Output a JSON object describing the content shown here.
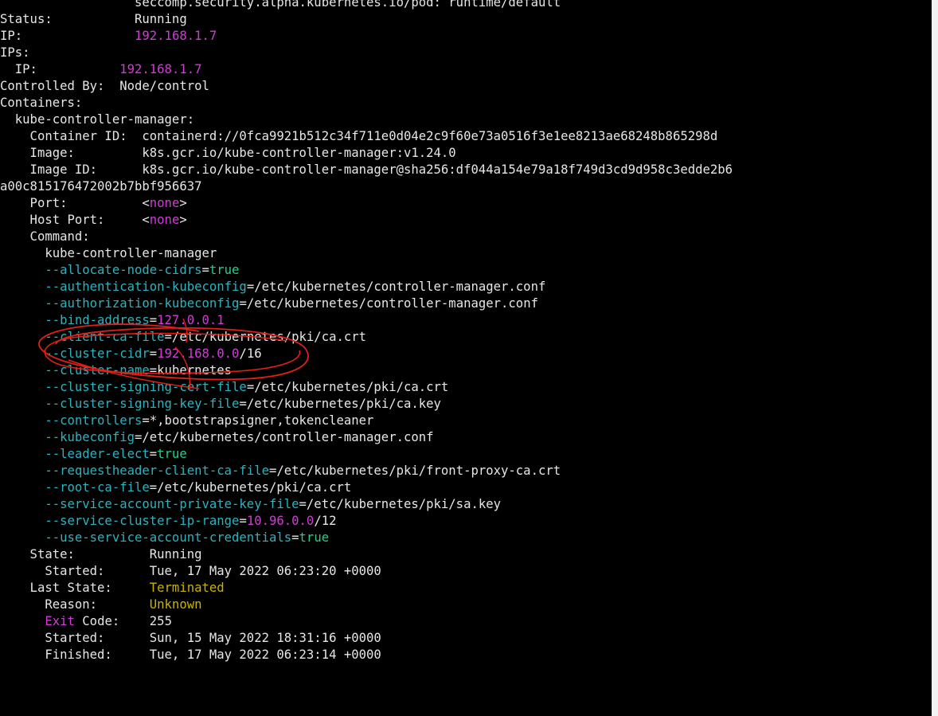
{
  "terminal": {
    "colors": {
      "background": "#000000",
      "text": "#e6e6e6",
      "flag": "#2bb3c0",
      "bool": "#23d18b",
      "number": "#d33ad8",
      "state": "#c8b400",
      "annotation": "#e0201a"
    },
    "lines": [
      [
        {
          "t": "                  seccomp.security.alpha.kubernetes.io/pod: runtime/default",
          "c": "white"
        }
      ],
      [
        {
          "t": "Status:           Running",
          "c": "white"
        }
      ],
      [
        {
          "t": "IP:               ",
          "c": "white"
        },
        {
          "t": "192.168.1.7",
          "c": "magenta"
        }
      ],
      [
        {
          "t": "IPs:",
          "c": "white"
        }
      ],
      [
        {
          "t": "  IP:           ",
          "c": "white"
        },
        {
          "t": "192.168.1.7",
          "c": "magenta"
        }
      ],
      [
        {
          "t": "Controlled By:  Node/control",
          "c": "white"
        }
      ],
      [
        {
          "t": "Containers:",
          "c": "white"
        }
      ],
      [
        {
          "t": "  kube-controller-manager:",
          "c": "white"
        }
      ],
      [
        {
          "t": "    Container ID:  containerd://0fca9921b512c34f711e0d04e2c9f60e73a0516f3e1ee8213ae68248b865298d",
          "c": "white"
        }
      ],
      [
        {
          "t": "    Image:         k8s.gcr.io/kube-controller-manager:v1.24.0",
          "c": "white"
        }
      ],
      [
        {
          "t": "    Image ID:      k8s.gcr.io/kube-controller-manager@sha256:df044a154e79a18f749d3cd9d958c3edde2b6",
          "c": "white"
        }
      ],
      [
        {
          "t": "a00c815176472002b7bbf956637",
          "c": "white"
        }
      ],
      [
        {
          "t": "    Port:          ",
          "c": "white"
        },
        {
          "t": "<",
          "c": "white"
        },
        {
          "t": "none",
          "c": "magenta"
        },
        {
          "t": ">",
          "c": "white"
        }
      ],
      [
        {
          "t": "    Host Port:     ",
          "c": "white"
        },
        {
          "t": "<",
          "c": "white"
        },
        {
          "t": "none",
          "c": "magenta"
        },
        {
          "t": ">",
          "c": "white"
        }
      ],
      [
        {
          "t": "    Command:",
          "c": "white"
        }
      ],
      [
        {
          "t": "      kube-controller-manager",
          "c": "white"
        }
      ],
      [
        {
          "t": "      --allocate-node-cidrs",
          "c": "cyan"
        },
        {
          "t": "=",
          "c": "white"
        },
        {
          "t": "true",
          "c": "green"
        }
      ],
      [
        {
          "t": "      --authentication-kubeconfig",
          "c": "cyan"
        },
        {
          "t": "=/etc/kubernetes/controller-manager.conf",
          "c": "white"
        }
      ],
      [
        {
          "t": "      --authorization-kubeconfig",
          "c": "cyan"
        },
        {
          "t": "=/etc/kubernetes/controller-manager.conf",
          "c": "white"
        }
      ],
      [
        {
          "t": "      --bind-address",
          "c": "cyan"
        },
        {
          "t": "=",
          "c": "white"
        },
        {
          "t": "127.0.0.1",
          "c": "magenta"
        }
      ],
      [
        {
          "t": "      --client-ca-file",
          "c": "cyan"
        },
        {
          "t": "=/etc/kubernetes/pki/ca.crt",
          "c": "white"
        }
      ],
      [
        {
          "t": "      --cluster-cidr",
          "c": "cyan"
        },
        {
          "t": "=",
          "c": "white"
        },
        {
          "t": "192.168.0.0",
          "c": "magenta"
        },
        {
          "t": "/16",
          "c": "white"
        }
      ],
      [
        {
          "t": "      --cluster-name",
          "c": "cyan"
        },
        {
          "t": "=kubernetes",
          "c": "white"
        }
      ],
      [
        {
          "t": "      --cluster-signing-cert-file",
          "c": "cyan"
        },
        {
          "t": "=/etc/kubernetes/pki/ca.crt",
          "c": "white"
        }
      ],
      [
        {
          "t": "      --cluster-signing-key-file",
          "c": "cyan"
        },
        {
          "t": "=/etc/kubernetes/pki/ca.key",
          "c": "white"
        }
      ],
      [
        {
          "t": "      --controllers",
          "c": "cyan"
        },
        {
          "t": "=*,bootstrapsigner,tokencleaner",
          "c": "white"
        }
      ],
      [
        {
          "t": "      --kubeconfig",
          "c": "cyan"
        },
        {
          "t": "=/etc/kubernetes/controller-manager.conf",
          "c": "white"
        }
      ],
      [
        {
          "t": "      --leader-elect",
          "c": "cyan"
        },
        {
          "t": "=",
          "c": "white"
        },
        {
          "t": "true",
          "c": "green"
        }
      ],
      [
        {
          "t": "      --requestheader-client-ca-file",
          "c": "cyan"
        },
        {
          "t": "=/etc/kubernetes/pki/front-proxy-ca.crt",
          "c": "white"
        }
      ],
      [
        {
          "t": "      --root-ca-file",
          "c": "cyan"
        },
        {
          "t": "=/etc/kubernetes/pki/ca.crt",
          "c": "white"
        }
      ],
      [
        {
          "t": "      --service-account-private-key-file",
          "c": "cyan"
        },
        {
          "t": "=/etc/kubernetes/pki/sa.key",
          "c": "white"
        }
      ],
      [
        {
          "t": "      --service-cluster-ip-range",
          "c": "cyan"
        },
        {
          "t": "=",
          "c": "white"
        },
        {
          "t": "10.96.0.0",
          "c": "magenta"
        },
        {
          "t": "/12",
          "c": "white"
        }
      ],
      [
        {
          "t": "      --use-service-account-credentials",
          "c": "cyan"
        },
        {
          "t": "=",
          "c": "white"
        },
        {
          "t": "true",
          "c": "green"
        }
      ],
      [
        {
          "t": "    State:          Running",
          "c": "white"
        }
      ],
      [
        {
          "t": "      Started:      Tue, 17 May 2022 06:23:20 +0000",
          "c": "white"
        }
      ],
      [
        {
          "t": "    Last State:     ",
          "c": "white"
        },
        {
          "t": "Terminated",
          "c": "yellow"
        }
      ],
      [
        {
          "t": "      Reason:       ",
          "c": "white"
        },
        {
          "t": "Unknown",
          "c": "yellow"
        }
      ],
      [
        {
          "t": "      ",
          "c": "white"
        },
        {
          "t": "Exit",
          "c": "magenta"
        },
        {
          "t": " Code:    255",
          "c": "white"
        }
      ],
      [
        {
          "t": "      Started:      Sun, 15 May 2022 18:31:16 +0000",
          "c": "white"
        }
      ],
      [
        {
          "t": "      Finished:     Tue, 17 May 2022 06:23:14 +0000",
          "c": "white"
        }
      ]
    ]
  }
}
